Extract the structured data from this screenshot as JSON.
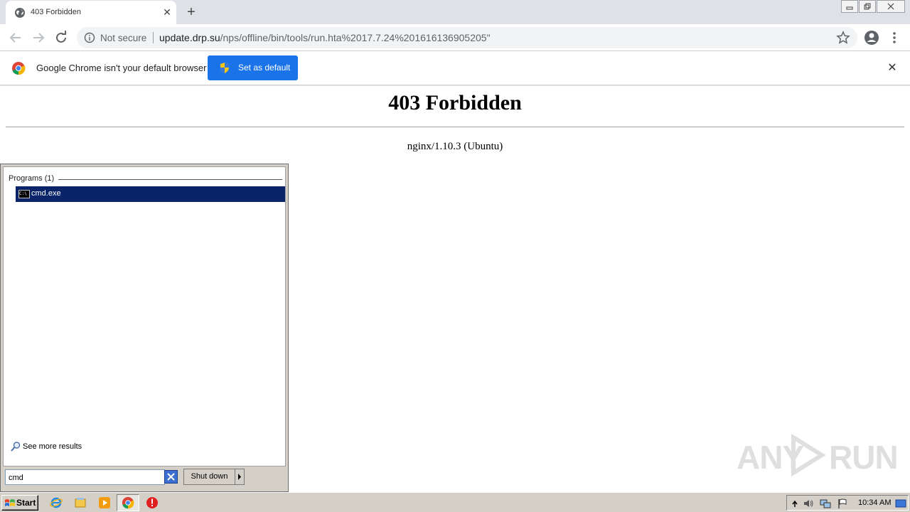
{
  "browser": {
    "tab": {
      "title": "403 Forbidden"
    },
    "omnibox": {
      "security_label": "Not secure",
      "url_host": "update.drp.su",
      "url_path": "/nps/offline/bin/tools/run.hta%2017.7.24%201616136905205\""
    },
    "infobar": {
      "message": "Google Chrome isn't your default browser",
      "button_label": "Set as default"
    }
  },
  "page": {
    "heading": "403 Forbidden",
    "server": "nginx/1.10.3 (Ubuntu)"
  },
  "start_menu": {
    "programs_heading": "Programs (1)",
    "programs": [
      {
        "label": "cmd.exe"
      }
    ],
    "see_more": "See more results",
    "search_value": "cmd",
    "shutdown_label": "Shut down"
  },
  "watermark": {
    "left": "ANY",
    "right": "RUN"
  },
  "taskbar": {
    "start_label": "Start",
    "clock": "10:34 AM"
  },
  "colors": {
    "chrome_blue": "#1a73e8",
    "selection_navy": "#0a246a",
    "taskbar_gray": "#d4d0c8"
  }
}
